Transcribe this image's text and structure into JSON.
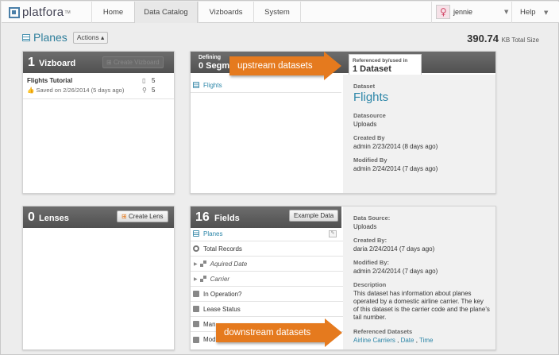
{
  "nav": {
    "logo_text": "platfora",
    "logo_tm": "TM",
    "tabs": [
      "Home",
      "Data Catalog",
      "Vizboards",
      "System"
    ],
    "active_tab": "Data Catalog",
    "user_name": "jennie",
    "help_label": "Help"
  },
  "header": {
    "title": "Planes",
    "actions_label": "Actions",
    "total_size_value": "390.74",
    "total_size_unit": "KB Total Size"
  },
  "vizboard_panel": {
    "count": "1",
    "label": "Vizboard",
    "create_label": "Create Vizboard",
    "item_title": "Flights Tutorial",
    "item_saved": "Saved on 2/26/2014 (5 days ago)",
    "item_stat1": "5",
    "item_stat2": "5"
  },
  "lenses_panel": {
    "count": "0",
    "label": "Lenses",
    "create_label": "Create Lens"
  },
  "segments_panel": {
    "defining_label": "Defining",
    "segments_text": "0 Segme",
    "ref_label": "Referenced by/used in",
    "ref_count": "1 Dataset",
    "row_label": "Flights",
    "dataset_label": "Dataset",
    "dataset_name": "Flights",
    "datasource_label": "Datasource",
    "datasource_value": "Uploads",
    "created_label": "Created By",
    "created_value": "admin 2/23/2014 (8 days ago)",
    "modified_label": "Modified By",
    "modified_value": "admin 2/24/2014 (7 days ago)"
  },
  "fields_panel": {
    "count": "16",
    "label": "Fields",
    "example_label": "Example Data",
    "rows": [
      "Planes",
      "Total Records",
      "Aquired Date",
      "Carrier",
      "In Operation?",
      "Lease Status",
      "Man",
      "Mod"
    ],
    "data_source_label": "Data Source:",
    "data_source_value": "Uploads",
    "created_label": "Created By:",
    "created_value": "daria 2/24/2014 (7 days ago)",
    "modified_label": "Modified By:",
    "modified_value": "admin 2/24/2014 (7 days ago)",
    "description_label": "Description",
    "description_text": "This dataset has information about planes operated by a domestic airline carrier. The key of this dataset is the carrier code and the plane's tail number.",
    "referenced_label": "Referenced Datasets",
    "ref_links": [
      "Airline Carriers",
      "Date",
      "Time"
    ]
  },
  "callouts": {
    "upstream": "upstream datasets",
    "downstream": "downstream datasets"
  },
  "colors": {
    "accent": "#2c86a8",
    "callout": "#e57a1e",
    "panel_head": "#5a5a5a"
  }
}
